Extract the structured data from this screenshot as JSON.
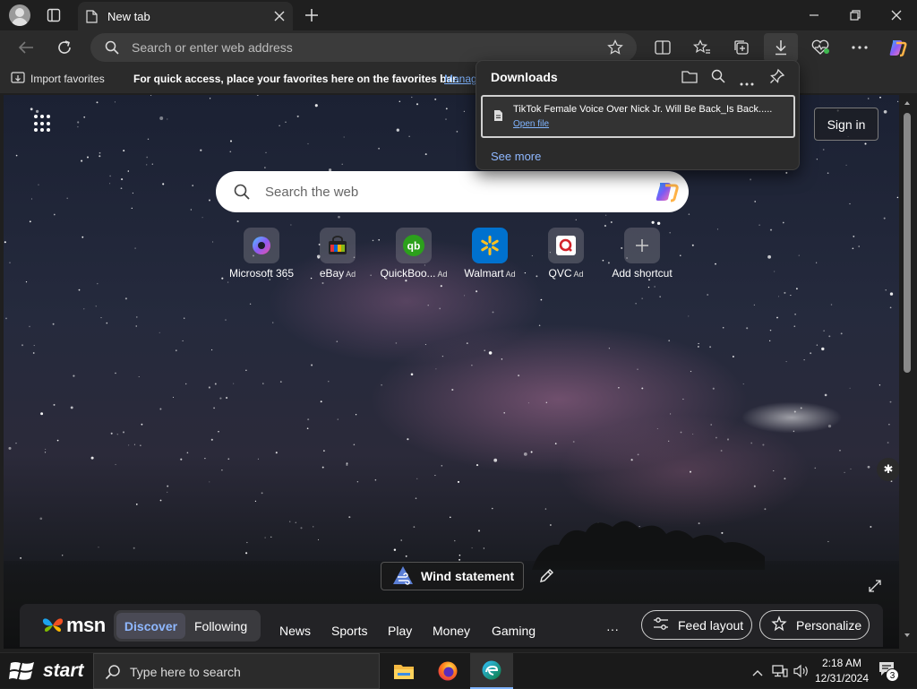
{
  "browser": {
    "tab_title": "New tab",
    "address_placeholder": "Search or enter web address"
  },
  "favorites_bar": {
    "import_label": "Import favorites",
    "hint_text": "For quick access, place your favorites here on the favorites bar.",
    "manage_link": "Manag"
  },
  "downloads": {
    "title": "Downloads",
    "items": [
      {
        "filename": "TikTok Female Voice Over Nick Jr. Will Be Back_Is Back.....",
        "action": "Open file"
      }
    ],
    "see_more": "See more"
  },
  "newtab": {
    "sign_in": "Sign in",
    "search_placeholder": "Search the web",
    "shortcuts": [
      {
        "label": "Microsoft 365",
        "ad": ""
      },
      {
        "label": "eBay",
        "ad": "Ad"
      },
      {
        "label": "QuickBoo...",
        "ad": "Ad"
      },
      {
        "label": "Walmart",
        "ad": "Ad"
      },
      {
        "label": "QVC",
        "ad": "Ad"
      },
      {
        "label": "Add shortcut",
        "ad": ""
      }
    ],
    "weather_label": "Wind statement"
  },
  "feed": {
    "brand": "msn",
    "tabs": {
      "discover": "Discover",
      "following": "Following"
    },
    "nav": [
      "News",
      "Sports",
      "Play",
      "Money",
      "Gaming"
    ],
    "more": "···",
    "feed_layout": "Feed layout",
    "personalize": "Personalize"
  },
  "taskbar": {
    "start": "start",
    "search_placeholder": "Type here to search",
    "time": "2:18 AM",
    "date": "12/31/2024",
    "notification_count": "3"
  },
  "colors": {
    "accent": "#7fb4ff",
    "toolbar": "#2b2b2b",
    "titlebar": "#1f1f1f"
  }
}
